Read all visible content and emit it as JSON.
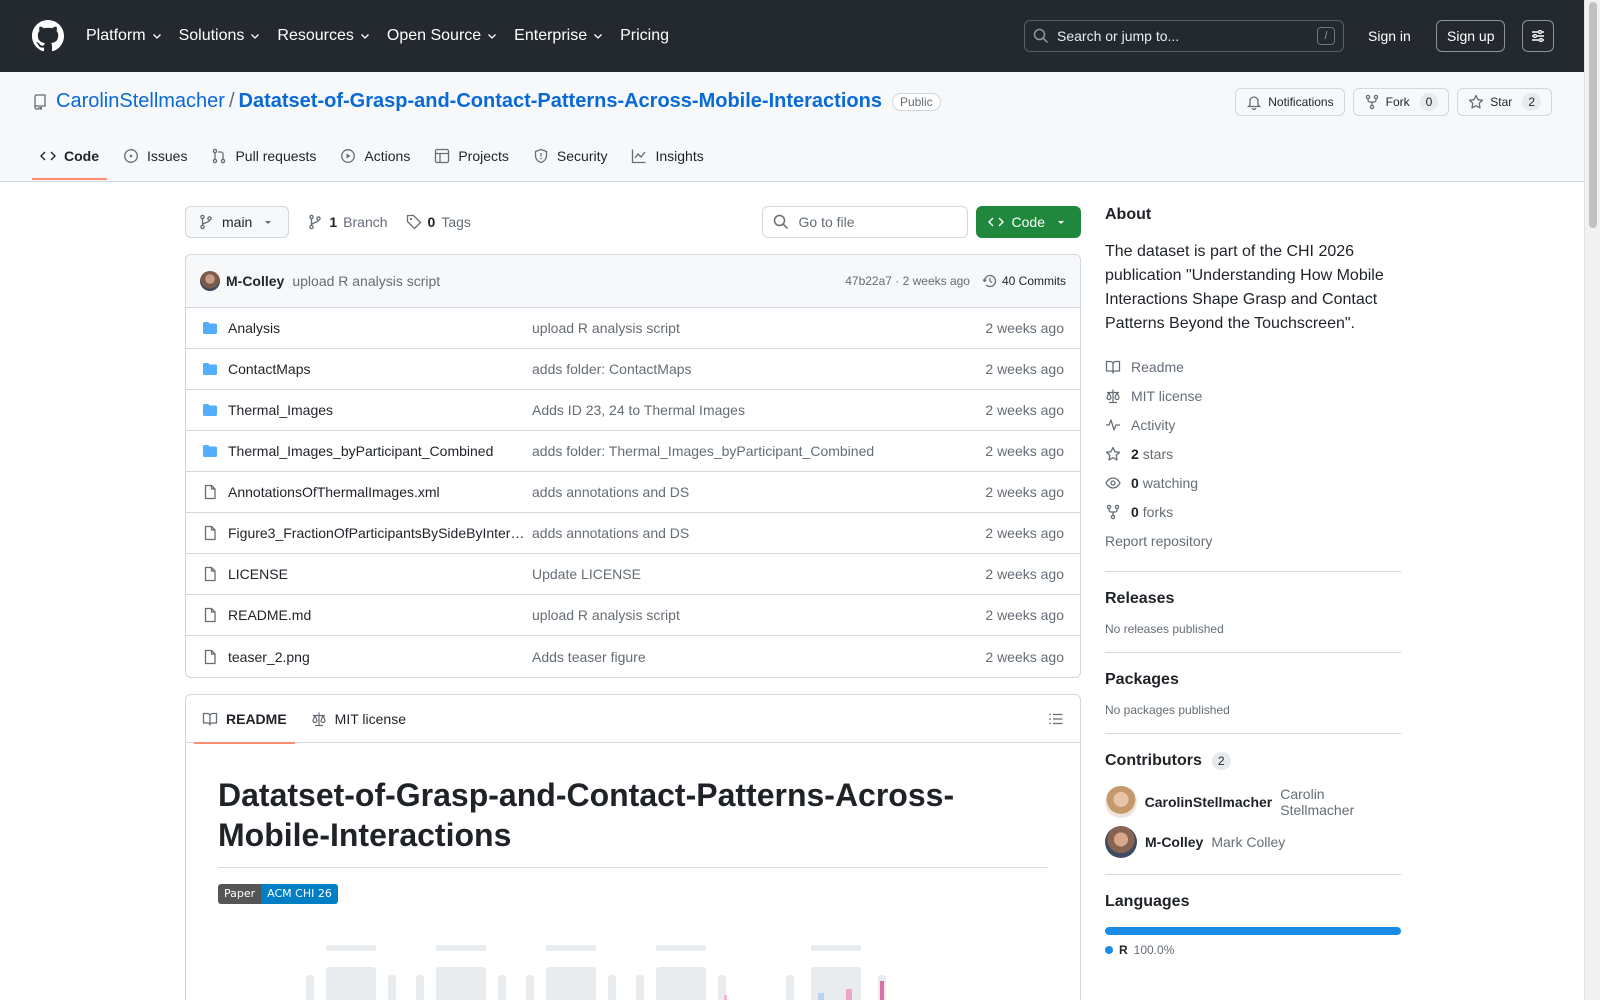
{
  "header": {
    "nav": [
      "Platform",
      "Solutions",
      "Resources",
      "Open Source",
      "Enterprise",
      "Pricing"
    ],
    "search_placeholder": "Search or jump to...",
    "search_key": "/",
    "signin": "Sign in",
    "signup": "Sign up"
  },
  "repo": {
    "owner": "CarolinStellmacher",
    "separator": "/",
    "name": "Datatset-of-Grasp-and-Contact-Patterns-Across-Mobile-Interactions",
    "visibility": "Public",
    "notifications": "Notifications",
    "fork_label": "Fork",
    "fork_count": "0",
    "star_label": "Star",
    "star_count": "2",
    "tabs": [
      "Code",
      "Issues",
      "Pull requests",
      "Actions",
      "Projects",
      "Security",
      "Insights"
    ]
  },
  "toolbar": {
    "branch": "main",
    "branch_count": "1",
    "branch_label": "Branch",
    "tag_count": "0",
    "tag_label": "Tags",
    "goto_placeholder": "Go to file",
    "code_label": "Code"
  },
  "commit": {
    "author": "M-Colley",
    "message": "upload R analysis script",
    "hash_time": "47b22a7 · 2 weeks ago",
    "commits": "40 Commits"
  },
  "files": [
    {
      "type": "dir",
      "name": "Analysis",
      "msg": "upload R analysis script",
      "date": "2 weeks ago"
    },
    {
      "type": "dir",
      "name": "ContactMaps",
      "msg": "adds folder: ContactMaps",
      "date": "2 weeks ago"
    },
    {
      "type": "dir",
      "name": "Thermal_Images",
      "msg": "Adds ID 23, 24 to Thermal Images",
      "date": "2 weeks ago"
    },
    {
      "type": "dir",
      "name": "Thermal_Images_byParticipant_Combined",
      "msg": "adds folder: Thermal_Images_byParticipant_Combined",
      "date": "2 weeks ago"
    },
    {
      "type": "file",
      "name": "AnnotationsOfThermalImages.xml",
      "msg": "adds annotations and DS",
      "date": "2 weeks ago"
    },
    {
      "type": "file",
      "name": "Figure3_FractionOfParticipantsBySideByInter…",
      "msg": "adds annotations and DS",
      "date": "2 weeks ago"
    },
    {
      "type": "file",
      "name": "LICENSE",
      "msg": "Update LICENSE",
      "date": "2 weeks ago"
    },
    {
      "type": "file",
      "name": "README.md",
      "msg": "upload R analysis script",
      "date": "2 weeks ago"
    },
    {
      "type": "file",
      "name": "teaser_2.png",
      "msg": "Adds teaser figure",
      "date": "2 weeks ago"
    }
  ],
  "readme": {
    "tab_readme": "README",
    "tab_license": "MIT license",
    "title": "Datatset-of-Grasp-and-Contact-Patterns-Across-Mobile-Interactions",
    "badge_left": "Paper",
    "badge_right": "ACM CHI 26"
  },
  "sidebar": {
    "about_title": "About",
    "about_desc": "The dataset is part of the CHI 2026 publication \"Understanding How Mobile Interactions Shape Grasp and Contact Patterns Beyond the Touchscreen\".",
    "readme": "Readme",
    "license": "MIT license",
    "activity": "Activity",
    "stars_count": "2",
    "stars_label": "stars",
    "watching_count": "0",
    "watching_label": "watching",
    "forks_count": "0",
    "forks_label": "forks",
    "report": "Report repository",
    "releases_title": "Releases",
    "releases_text": "No releases published",
    "packages_title": "Packages",
    "packages_text": "No packages published",
    "contributors_title": "Contributors",
    "contributors_count": "2",
    "contributors": [
      {
        "login": "CarolinStellmacher",
        "name": "Carolin Stellmacher"
      },
      {
        "login": "M-Colley",
        "name": "Mark Colley"
      }
    ],
    "languages_title": "Languages",
    "language": "R",
    "language_pct": "100.0%",
    "language_color": "#198ce7"
  }
}
